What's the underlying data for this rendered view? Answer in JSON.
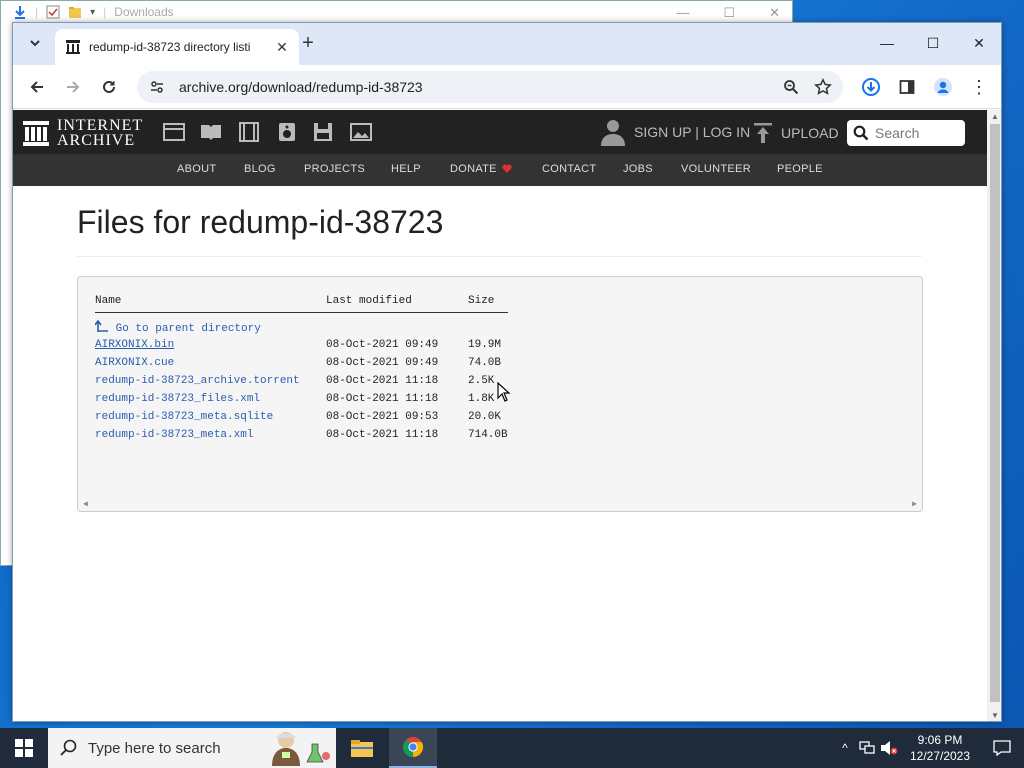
{
  "explorer": {
    "title": "Downloads"
  },
  "browser": {
    "tab_title": "redump-id-38723 directory listi",
    "url": "archive.org/download/redump-id-38723"
  },
  "ia": {
    "logo_line1": "INTERNET",
    "logo_line2": "ARCHIVE",
    "signup": "SIGN UP | LOG IN",
    "upload": "UPLOAD",
    "search_placeholder": "Search",
    "nav": [
      "ABOUT",
      "BLOG",
      "PROJECTS",
      "HELP",
      "DONATE",
      "CONTACT",
      "JOBS",
      "VOLUNTEER",
      "PEOPLE"
    ]
  },
  "page": {
    "title": "Files for redump-id-38723",
    "columns": {
      "name": "Name",
      "modified": "Last modified",
      "size": "Size"
    },
    "parent_link": "Go to parent directory",
    "files": [
      {
        "name": "AIRXONIX.bin",
        "modified": "08-Oct-2021 09:49",
        "size": "19.9M"
      },
      {
        "name": "AIRXONIX.cue",
        "modified": "08-Oct-2021 09:49",
        "size": "74.0B"
      },
      {
        "name": "redump-id-38723_archive.torrent",
        "modified": "08-Oct-2021 11:18",
        "size": "2.5K"
      },
      {
        "name": "redump-id-38723_files.xml",
        "modified": "08-Oct-2021 11:18",
        "size": "1.8K"
      },
      {
        "name": "redump-id-38723_meta.sqlite",
        "modified": "08-Oct-2021 09:53",
        "size": "20.0K"
      },
      {
        "name": "redump-id-38723_meta.xml",
        "modified": "08-Oct-2021 11:18",
        "size": "714.0B"
      }
    ]
  },
  "taskbar": {
    "search_placeholder": "Type here to search",
    "time": "9:06 PM",
    "date": "12/27/2023"
  },
  "colors": {
    "link": "#2a5db0",
    "ia_top": "#222222",
    "ia_nav": "#333333",
    "donate_heart": "#e03030",
    "tabstrip": "#dee7f7"
  }
}
